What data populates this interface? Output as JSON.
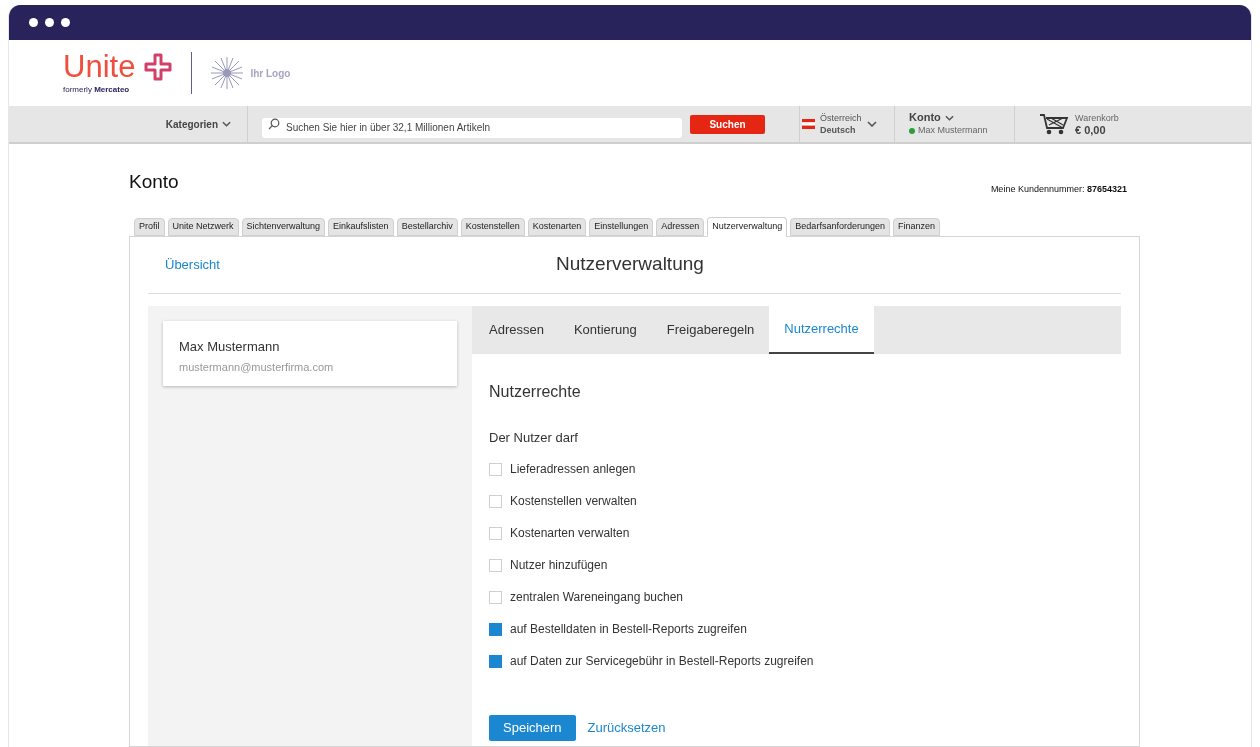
{
  "logo": {
    "brand": "Unite",
    "tagline_prefix": "formerly",
    "tagline_brand": "Mercateo",
    "partner": "Ihr Logo"
  },
  "navbar": {
    "categories": "Kategorien",
    "search_placeholder": "Suchen Sie hier in über 32,1 Millionen Artikeln",
    "search_button": "Suchen",
    "country": "Österreich",
    "language": "Deutsch",
    "account": "Konto",
    "user": "Max Mustermann",
    "cart_label": "Warenkorb",
    "cart_total": "€ 0,00"
  },
  "page": {
    "title": "Konto",
    "customer_label": "Meine Kundennummer:",
    "customer_number": "87654321"
  },
  "tabs": [
    {
      "label": "Profil",
      "selected": false
    },
    {
      "label": "Unite Netzwerk",
      "selected": false
    },
    {
      "label": "Sichtenverwaltung",
      "selected": false
    },
    {
      "label": "Einkaufslisten",
      "selected": false
    },
    {
      "label": "Bestellarchiv",
      "selected": false
    },
    {
      "label": "Kostenstellen",
      "selected": false
    },
    {
      "label": "Kostenarten",
      "selected": false
    },
    {
      "label": "Einstellungen",
      "selected": false
    },
    {
      "label": "Adressen",
      "selected": false
    },
    {
      "label": "Nutzerverwaltung",
      "selected": true
    },
    {
      "label": "Bedarfsanforderungen",
      "selected": false
    },
    {
      "label": "Finanzen",
      "selected": false
    }
  ],
  "panel": {
    "back_link": "Übersicht",
    "title": "Nutzerverwaltung"
  },
  "user_card": {
    "name": "Max Mustermann",
    "email": "mustermann@musterfirma.com"
  },
  "subtabs": [
    {
      "label": "Adressen",
      "selected": false
    },
    {
      "label": "Kontierung",
      "selected": false
    },
    {
      "label": "Freigaberegeln",
      "selected": false
    },
    {
      "label": "Nutzerrechte",
      "selected": true
    }
  ],
  "rights": {
    "heading": "Nutzerrechte",
    "intro": "Der Nutzer darf",
    "items": [
      {
        "label": "Lieferadressen anlegen",
        "checked": false
      },
      {
        "label": "Kostenstellen verwalten",
        "checked": false
      },
      {
        "label": "Kostenarten verwalten",
        "checked": false
      },
      {
        "label": "Nutzer hinzufügen",
        "checked": false
      },
      {
        "label": "zentralen Wareneingang buchen",
        "checked": false
      },
      {
        "label": "auf Bestelldaten in Bestell-Reports zugreifen",
        "checked": true
      },
      {
        "label": "auf Daten zur Servicegebühr in Bestell-Reports zugreifen",
        "checked": true
      }
    ],
    "save": "Speichern",
    "reset": "Zurücksetzen"
  }
}
